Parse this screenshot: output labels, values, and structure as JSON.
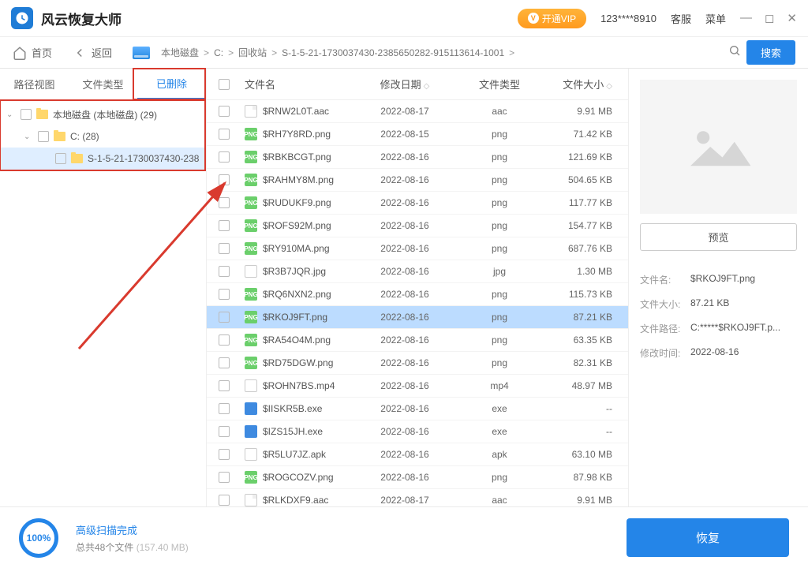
{
  "app": {
    "title": "风云恢复大师",
    "vip": "开通VIP",
    "user": "123****8910",
    "help": "客服",
    "menu": "菜单"
  },
  "toolbar": {
    "home": "首页",
    "back": "返回",
    "search": "搜索"
  },
  "breadcrumb": [
    "本地磁盘",
    "C:",
    "回收站",
    "S-1-5-21-1730037430-2385650282-915113614-1001"
  ],
  "tabs": {
    "path": "路径视图",
    "type": "文件类型",
    "deleted": "已删除"
  },
  "tree": [
    {
      "indent": 0,
      "label": "本地磁盘 (本地磁盘) (29)",
      "chev": true
    },
    {
      "indent": 1,
      "label": "C: (28)",
      "chev": true
    },
    {
      "indent": 2,
      "label": "S-1-5-21-1730037430-238",
      "chev": false,
      "selected": true
    }
  ],
  "columns": {
    "name": "文件名",
    "date": "修改日期",
    "type": "文件类型",
    "size": "文件大小"
  },
  "files": [
    {
      "icon": "aac",
      "name": "$RNW2L0T.aac",
      "date": "2022-08-17",
      "type": "aac",
      "size": "9.91  MB"
    },
    {
      "icon": "png",
      "name": "$RH7Y8RD.png",
      "date": "2022-08-15",
      "type": "png",
      "size": "71.42  KB"
    },
    {
      "icon": "png",
      "name": "$RBKBCGT.png",
      "date": "2022-08-16",
      "type": "png",
      "size": "121.69  KB"
    },
    {
      "icon": "png",
      "name": "$RAHMY8M.png",
      "date": "2022-08-16",
      "type": "png",
      "size": "504.65  KB"
    },
    {
      "icon": "png",
      "name": "$RUDUKF9.png",
      "date": "2022-08-16",
      "type": "png",
      "size": "117.77  KB"
    },
    {
      "icon": "png",
      "name": "$ROFS92M.png",
      "date": "2022-08-16",
      "type": "png",
      "size": "154.77  KB"
    },
    {
      "icon": "png",
      "name": "$RY910MA.png",
      "date": "2022-08-16",
      "type": "png",
      "size": "687.76  KB"
    },
    {
      "icon": "jpg",
      "name": "$R3B7JQR.jpg",
      "date": "2022-08-16",
      "type": "jpg",
      "size": "1.30  MB"
    },
    {
      "icon": "png",
      "name": "$RQ6NXN2.png",
      "date": "2022-08-16",
      "type": "png",
      "size": "115.73  KB"
    },
    {
      "icon": "png",
      "name": "$RKOJ9FT.png",
      "date": "2022-08-16",
      "type": "png",
      "size": "87.21  KB",
      "selected": true
    },
    {
      "icon": "png",
      "name": "$RA54O4M.png",
      "date": "2022-08-16",
      "type": "png",
      "size": "63.35  KB"
    },
    {
      "icon": "png",
      "name": "$RD75DGW.png",
      "date": "2022-08-16",
      "type": "png",
      "size": "82.31  KB"
    },
    {
      "icon": "mp4",
      "name": "$ROHN7BS.mp4",
      "date": "2022-08-16",
      "type": "mp4",
      "size": "48.97  MB"
    },
    {
      "icon": "exe",
      "name": "$IISKR5B.exe",
      "date": "2022-08-16",
      "type": "exe",
      "size": "--"
    },
    {
      "icon": "exe",
      "name": "$IZS15JH.exe",
      "date": "2022-08-16",
      "type": "exe",
      "size": "--"
    },
    {
      "icon": "apk",
      "name": "$R5LU7JZ.apk",
      "date": "2022-08-16",
      "type": "apk",
      "size": "63.10  MB"
    },
    {
      "icon": "png",
      "name": "$ROGCOZV.png",
      "date": "2022-08-16",
      "type": "png",
      "size": "87.98  KB"
    },
    {
      "icon": "aac",
      "name": "$RLKDXF9.aac",
      "date": "2022-08-17",
      "type": "aac",
      "size": "9.91  MB"
    }
  ],
  "preview": {
    "button": "预览",
    "labels": {
      "name": "文件名:",
      "size": "文件大小:",
      "path": "文件路径:",
      "mtime": "修改时间:"
    },
    "name": "$RKOJ9FT.png",
    "size": "87.21 KB",
    "path": "C:*****$RKOJ9FT.p...",
    "mtime": "2022-08-16"
  },
  "footer": {
    "percent": "100%",
    "status": "高级扫描完成",
    "detail_prefix": "总共48个文件 ",
    "detail_size": "(157.40 MB)",
    "recover": "恢复"
  }
}
